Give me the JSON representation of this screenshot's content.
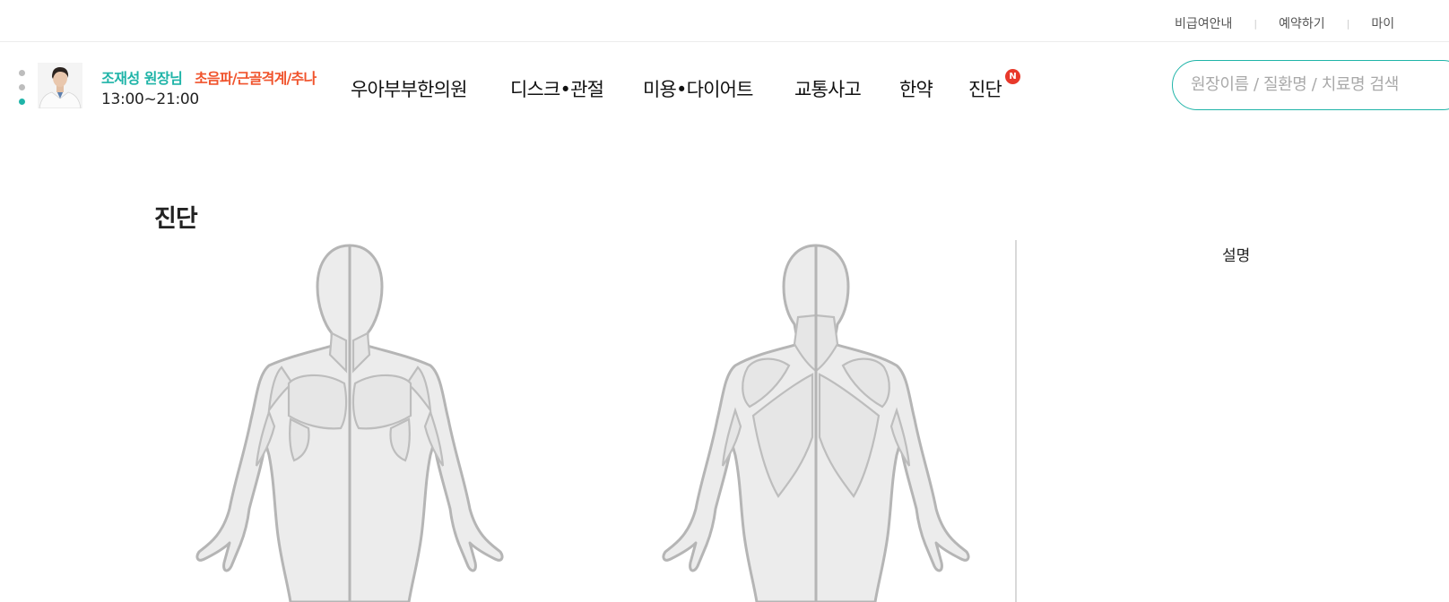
{
  "util_links": [
    "비급여안내",
    "예약하기",
    "마이"
  ],
  "doctor": {
    "name": "조재성 원장님",
    "specialty": "초음파/근골격계/추나",
    "hours": "13:00~21:00"
  },
  "nav": [
    "우아부부한의원",
    "디스크•관절",
    "미용•다이어트",
    "교통사고",
    "한약",
    "진단"
  ],
  "nav_badge": "N",
  "search": {
    "placeholder": "원장이름 / 질환명 / 치료명 검색"
  },
  "page_title": "진단",
  "description_title": "설명",
  "colors": {
    "accent": "#1fb4a8",
    "highlight": "#f0542d",
    "badge": "#e8392b"
  },
  "icons": {
    "search_icon": "search-icon"
  }
}
